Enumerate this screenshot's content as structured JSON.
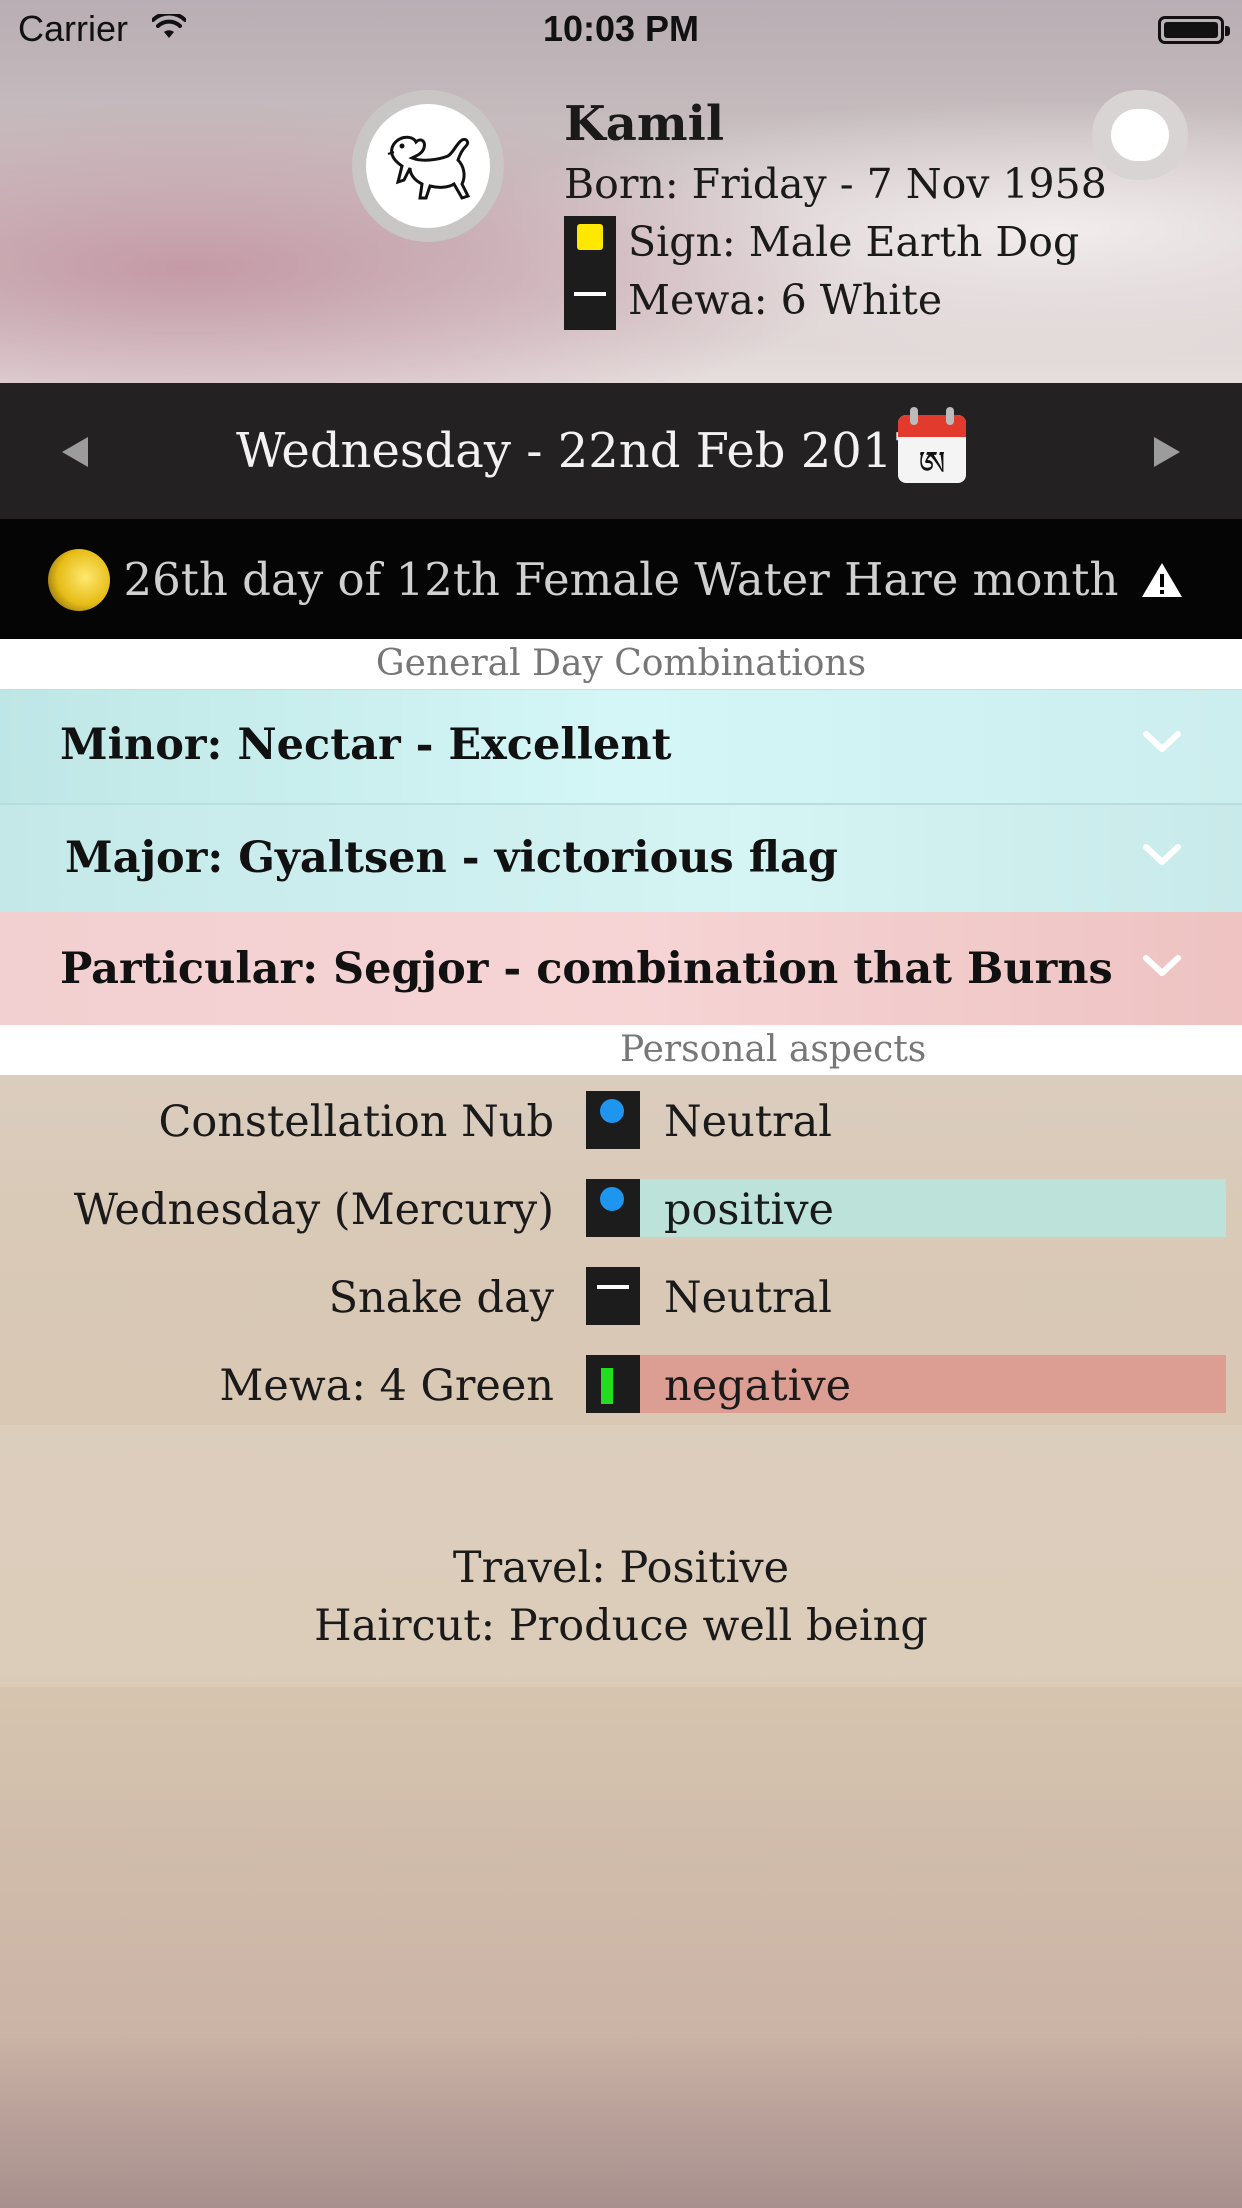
{
  "status_bar": {
    "carrier": "Carrier",
    "time": "10:03 PM"
  },
  "profile": {
    "name": "Kamil",
    "born": "Born: Friday - 7 Nov 1958",
    "sign": "Sign: Male Earth Dog",
    "mewa": "Mewa: 6 White",
    "sign_color": "#ffe800",
    "avatar_icon": "dog-icon"
  },
  "date_nav": {
    "date": "Wednesday - 22nd Feb 2017",
    "calendar_icon": "tibetan-calendar-icon",
    "calendar_glyph": "ཨ"
  },
  "lunar": {
    "text": "26th day of 12th Female Water Hare month",
    "moon_icon": "moon-phase-icon",
    "warning_icon": "warning-icon"
  },
  "general": {
    "header": "General Day Combinations",
    "items": [
      {
        "label": "Minor: Nectar - Excellent",
        "color": "#d2f3f3"
      },
      {
        "label": "Major: Gyaltsen - victorious flag",
        "color": "#d2f3f3"
      },
      {
        "label": "Particular: Segjor - combination that Burns",
        "color": "#f4d0d1"
      }
    ]
  },
  "personal": {
    "header": "Personal aspects",
    "items": [
      {
        "name": "Constellation Nub",
        "value": "Neutral",
        "icon": "blue-dot-icon"
      },
      {
        "name": "Wednesday (Mercury)",
        "value": "positive",
        "icon": "blue-dot-icon",
        "color": "#bde2da"
      },
      {
        "name": "Snake day",
        "value": "Neutral",
        "icon": "white-dash-icon"
      },
      {
        "name": "Mewa: 4 Green",
        "value": "negative",
        "icon": "green-bar-icon",
        "color": "#dc9e92"
      }
    ]
  },
  "activities": {
    "travel": "Travel: Positive",
    "haircut": "Haircut: Produce well being"
  }
}
